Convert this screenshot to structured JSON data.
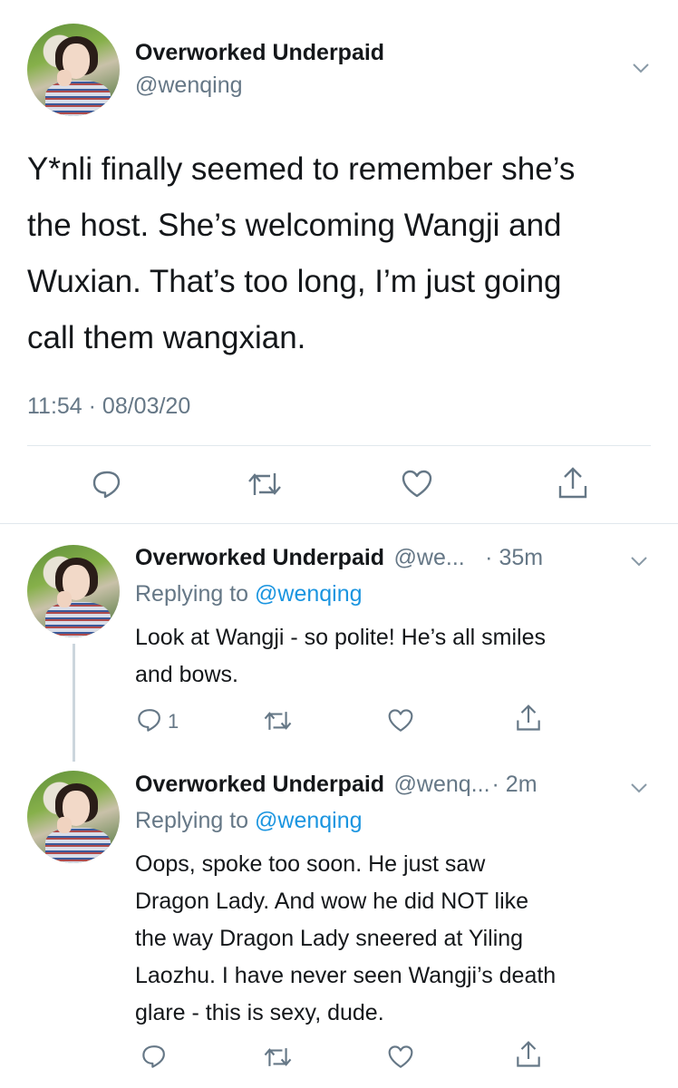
{
  "main_tweet": {
    "author_name": "Overworked Underpaid",
    "handle": "@wenqing",
    "lines": [
      "Y*nli finally seemed to remember she’s",
      "the host. She’s welcoming Wangji and",
      "Wuxian. That’s too long, I’m just going",
      "call them wangxian."
    ],
    "timestamp": "11:54 · 08/03/20"
  },
  "replies": [
    {
      "author_name": "Overworked Underpaid",
      "handle_truncated": "@we...",
      "time": "· 35m",
      "replying_prefix": "Replying to",
      "replying_handle": "@wenqing",
      "lines": [
        "Look at Wangji - so polite! He’s all smiles",
        "and bows."
      ],
      "reply_count": "1"
    },
    {
      "author_name": "Overworked Underpaid",
      "handle_truncated": "@wenq...",
      "time": "· 2m",
      "replying_prefix": "Replying to",
      "replying_handle": "@wenqing",
      "lines": [
        "Oops, spoke too soon. He just saw",
        "Dragon Lady. And wow he did NOT like",
        "the way Dragon Lady sneered at Yiling",
        "Laozhu. I have never seen Wangji’s death",
        "glare - this is sexy, dude."
      ],
      "reply_count": ""
    }
  ],
  "icons": {
    "reply": "reply-icon",
    "retweet": "retweet-icon",
    "like": "heart-icon",
    "share": "share-icon",
    "more": "chevron-down-icon"
  },
  "colors": {
    "text": "#14171a",
    "secondary": "#657786",
    "link": "#1b95e0",
    "divider": "#e1e8ed"
  }
}
